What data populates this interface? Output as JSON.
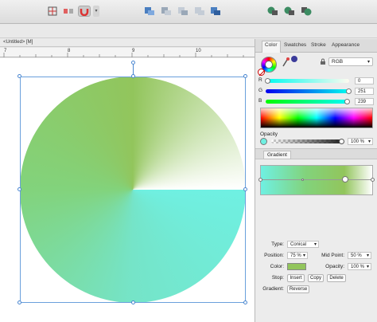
{
  "document": {
    "tab_label": "<Untitled> [M]"
  },
  "ruler": {
    "labels": [
      "7",
      "8",
      "9",
      "10"
    ]
  },
  "panel": {
    "tabs": [
      "Color",
      "Swatches",
      "Stroke",
      "Appearance"
    ],
    "color": {
      "model": "RGB",
      "r_label": "R",
      "g_label": "G",
      "b_label": "B",
      "r_value": "0",
      "g_value": "251",
      "b_value": "239",
      "opacity_label": "Opacity",
      "opacity_value": "100 %"
    },
    "gradient": {
      "tab_label": "Gradient",
      "type_label": "Type:",
      "type_value": "Conical",
      "position_label": "Position:",
      "position_value": "75 %",
      "midpoint_label": "Mid Point:",
      "midpoint_value": "50 %",
      "color_label": "Color:",
      "opacity_label": "Opacity:",
      "opacity_value": "100 %",
      "stop_label": "Stop:",
      "insert_button": "Insert",
      "copy_button": "Copy",
      "delete_button": "Delete",
      "gradient_label": "Gradient:",
      "reverse_button": "Reverse"
    }
  },
  "colors": {
    "green": "#92c55c",
    "cyan": "#6ff0e2",
    "white": "#ffffff",
    "selection": "#4a86d0"
  },
  "icons": {
    "toolbar": [
      "grid-icon",
      "align-icon",
      "snap-magnet-icon",
      "boolean-add-icon",
      "boolean-subtract-icon",
      "boolean-intersect-icon",
      "boolean-xor-icon",
      "boolean-divide-icon",
      "arrange-back-icon",
      "arrange-group-icon",
      "arrange-front-icon"
    ]
  }
}
